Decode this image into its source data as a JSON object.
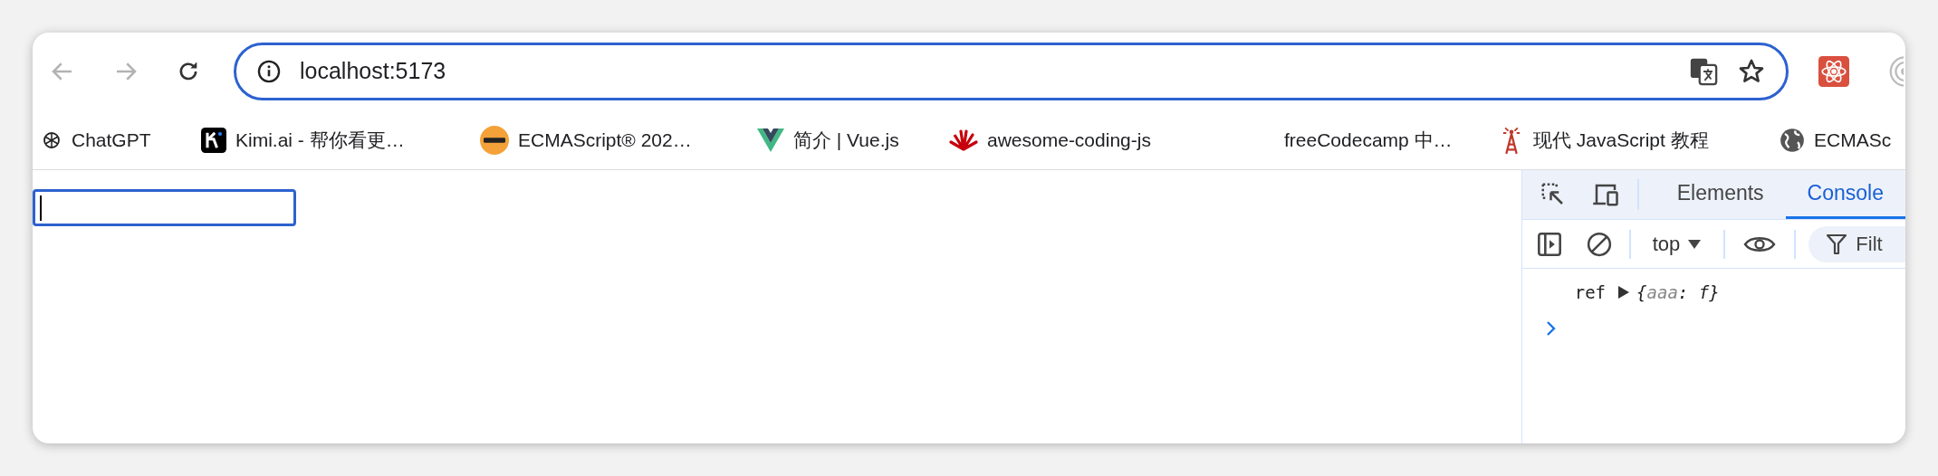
{
  "toolbar": {
    "url": "localhost:5173",
    "address_focused": true
  },
  "bookmarks": [
    {
      "label": "ChatGPT"
    },
    {
      "label": "Kimi.ai - 帮你看更…"
    },
    {
      "label": "ECMAScript® 202…"
    },
    {
      "label": "简介 | Vue.js"
    },
    {
      "label": "awesome-coding-js"
    },
    {
      "label": "freeCodecamp 中…"
    },
    {
      "label": "现代 JavaScript 教程"
    },
    {
      "label": "ECMASc"
    }
  ],
  "page": {
    "input": {
      "focused": true
    }
  },
  "devtools": {
    "tabs": [
      {
        "label": "Elements",
        "selected": false
      },
      {
        "label": "Console",
        "selected": true
      }
    ],
    "context": "top",
    "filter_placeholder": "Filt",
    "messages": [
      {
        "label": "ref",
        "open": "{",
        "key": "aaa",
        "rest": ": f}"
      }
    ]
  }
}
